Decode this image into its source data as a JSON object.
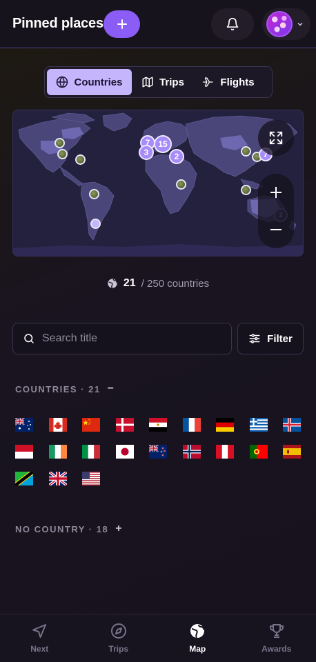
{
  "header": {
    "title": "Pinned places",
    "add_icon": "plus-icon",
    "notifications_icon": "bell-icon",
    "avatar_menu_icon": "chevron-down-icon"
  },
  "tabs": [
    {
      "label": "Countries",
      "icon": "globe-icon",
      "active": true
    },
    {
      "label": "Trips",
      "icon": "map-icon",
      "active": false
    },
    {
      "label": "Flights",
      "icon": "plane-icon",
      "active": false
    }
  ],
  "map": {
    "clusters": [
      "7",
      "15",
      "3",
      "2",
      "7",
      "2"
    ],
    "controls": [
      "fullscreen-icon",
      "zoom-in-icon",
      "zoom-out-icon"
    ]
  },
  "stats": {
    "visited": "21",
    "total_text": "/ 250 countries"
  },
  "search": {
    "placeholder": "Search title",
    "value": ""
  },
  "filter": {
    "label": "Filter"
  },
  "countries_section": {
    "label": "COUNTRIES · 21",
    "toggle": "−",
    "flags": [
      "Australia",
      "Canada",
      "China",
      "Denmark",
      "Egypt",
      "France",
      "Germany",
      "Greece",
      "Iceland",
      "Indonesia",
      "Ireland",
      "Italy",
      "Japan",
      "New Zealand",
      "Norway",
      "Peru",
      "Portugal",
      "Spain",
      "Tanzania",
      "United Kingdom",
      "United States"
    ]
  },
  "no_country_section": {
    "label": "NO COUNTRY · 18",
    "toggle": "+"
  },
  "bottom_nav": [
    {
      "label": "Next",
      "icon": "navigation-arrow-icon",
      "active": false
    },
    {
      "label": "Trips",
      "icon": "compass-icon",
      "active": false
    },
    {
      "label": "Map",
      "icon": "globe-icon",
      "active": true
    },
    {
      "label": "Awards",
      "icon": "trophy-icon",
      "active": false
    }
  ],
  "colors": {
    "accent": "#8b5cf6",
    "accent_light": "#c4b5fd",
    "background": "#17131c",
    "muted_text": "#8e8899"
  }
}
